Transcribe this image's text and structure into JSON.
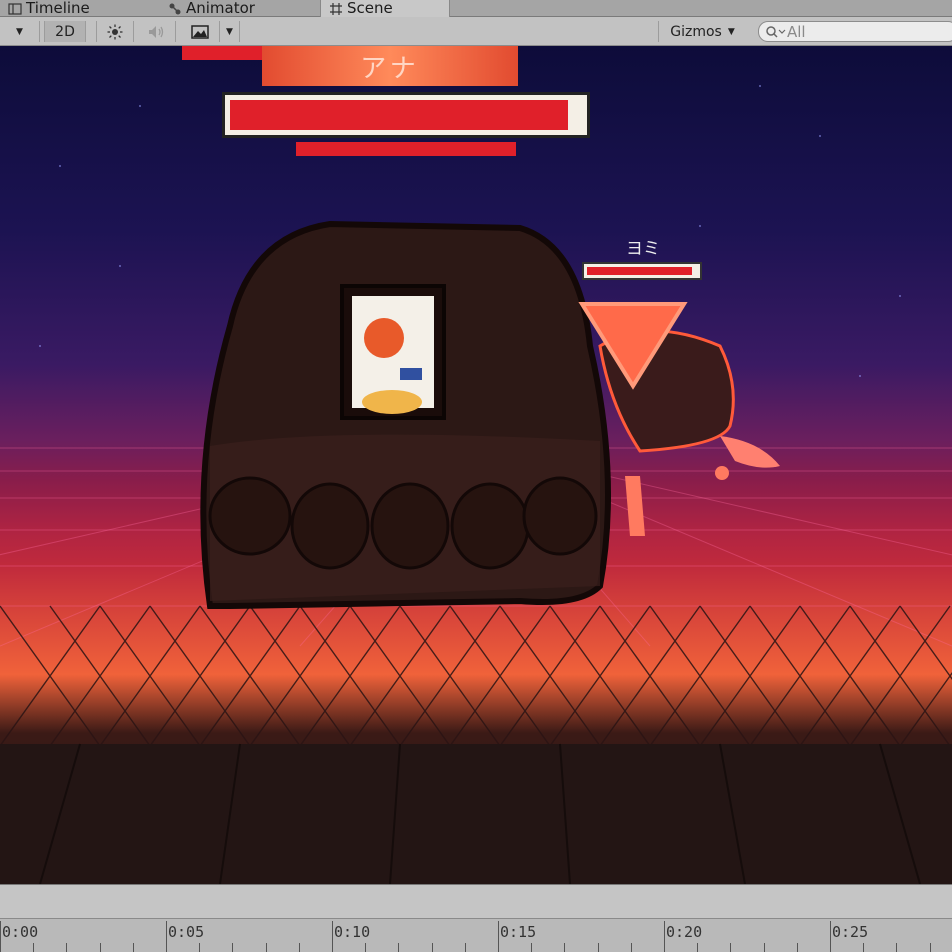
{
  "tabs": [
    {
      "label": "Timeline",
      "icon": "timeline-icon"
    },
    {
      "label": "Animator",
      "icon": "animator-icon"
    },
    {
      "label": "Scene",
      "icon": "scene-grid-icon",
      "active": true
    }
  ],
  "toolbar": {
    "mode_2d": "2D",
    "gizmos": "Gizmos",
    "search_placeholder": "All"
  },
  "scene": {
    "boss_name": "アナ",
    "boss_hp_fraction": 0.96,
    "enemy_name": "ヨミ",
    "enemy_hp_fraction": 0.95
  },
  "timeline": {
    "ticks": [
      "0:00",
      "0:05",
      "0:10",
      "0:15",
      "0:20",
      "0:25"
    ]
  },
  "colors": {
    "hp_red": "#e0202a",
    "ui_gray": "#c2c2c2",
    "sky_top": "#0d0c3a",
    "horizon_orange": "#f0623a"
  }
}
